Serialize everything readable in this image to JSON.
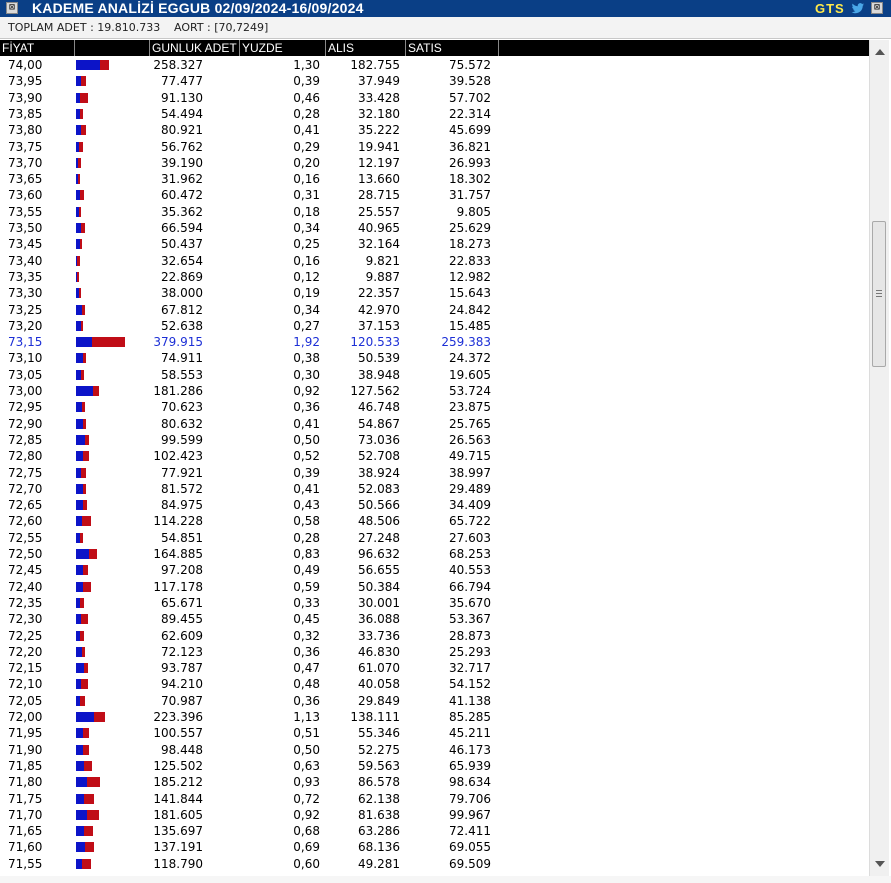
{
  "window": {
    "close_glyph": "⊠",
    "title": "KADEME ANALİZİ EGGUB 02/09/2024-16/09/2024",
    "brand": "GTS",
    "brand_icon": "twitter-bird-icon",
    "right_close_glyph": "⊠"
  },
  "summary": {
    "total_label": "TOPLAM ADET : 19.810.733",
    "aort_label": "AORT :  [70,7249]"
  },
  "columns": {
    "price": "FİYAT",
    "volume": "GUNLUK ADET",
    "percent": "YUZDE",
    "buy": "ALIS",
    "sell": "SATIS"
  },
  "colors": {
    "title_bg": "#0a3f86",
    "brand": "#ffe94a",
    "header_bg": "#000000",
    "buy_bar": "#0c14c8",
    "sell_bar": "#c00d17",
    "highlight_text": "#1c2fd6"
  },
  "highlight_price": "73,15",
  "rows": [
    {
      "price": "74,00",
      "volume": "258.327",
      "percent": "1,30",
      "buy": "182.755",
      "sell": "75.572",
      "buy_n": 182755,
      "sell_n": 75572
    },
    {
      "price": "73,95",
      "volume": "77.477",
      "percent": "0,39",
      "buy": "37.949",
      "sell": "39.528",
      "buy_n": 37949,
      "sell_n": 39528
    },
    {
      "price": "73,90",
      "volume": "91.130",
      "percent": "0,46",
      "buy": "33.428",
      "sell": "57.702",
      "buy_n": 33428,
      "sell_n": 57702
    },
    {
      "price": "73,85",
      "volume": "54.494",
      "percent": "0,28",
      "buy": "32.180",
      "sell": "22.314",
      "buy_n": 32180,
      "sell_n": 22314
    },
    {
      "price": "73,80",
      "volume": "80.921",
      "percent": "0,41",
      "buy": "35.222",
      "sell": "45.699",
      "buy_n": 35222,
      "sell_n": 45699
    },
    {
      "price": "73,75",
      "volume": "56.762",
      "percent": "0,29",
      "buy": "19.941",
      "sell": "36.821",
      "buy_n": 19941,
      "sell_n": 36821
    },
    {
      "price": "73,70",
      "volume": "39.190",
      "percent": "0,20",
      "buy": "12.197",
      "sell": "26.993",
      "buy_n": 12197,
      "sell_n": 26993
    },
    {
      "price": "73,65",
      "volume": "31.962",
      "percent": "0,16",
      "buy": "13.660",
      "sell": "18.302",
      "buy_n": 13660,
      "sell_n": 18302
    },
    {
      "price": "73,60",
      "volume": "60.472",
      "percent": "0,31",
      "buy": "28.715",
      "sell": "31.757",
      "buy_n": 28715,
      "sell_n": 31757
    },
    {
      "price": "73,55",
      "volume": "35.362",
      "percent": "0,18",
      "buy": "25.557",
      "sell": "9.805",
      "buy_n": 25557,
      "sell_n": 9805
    },
    {
      "price": "73,50",
      "volume": "66.594",
      "percent": "0,34",
      "buy": "40.965",
      "sell": "25.629",
      "buy_n": 40965,
      "sell_n": 25629
    },
    {
      "price": "73,45",
      "volume": "50.437",
      "percent": "0,25",
      "buy": "32.164",
      "sell": "18.273",
      "buy_n": 32164,
      "sell_n": 18273
    },
    {
      "price": "73,40",
      "volume": "32.654",
      "percent": "0,16",
      "buy": "9.821",
      "sell": "22.833",
      "buy_n": 9821,
      "sell_n": 22833
    },
    {
      "price": "73,35",
      "volume": "22.869",
      "percent": "0,12",
      "buy": "9.887",
      "sell": "12.982",
      "buy_n": 9887,
      "sell_n": 12982
    },
    {
      "price": "73,30",
      "volume": "38.000",
      "percent": "0,19",
      "buy": "22.357",
      "sell": "15.643",
      "buy_n": 22357,
      "sell_n": 15643
    },
    {
      "price": "73,25",
      "volume": "67.812",
      "percent": "0,34",
      "buy": "42.970",
      "sell": "24.842",
      "buy_n": 42970,
      "sell_n": 24842
    },
    {
      "price": "73,20",
      "volume": "52.638",
      "percent": "0,27",
      "buy": "37.153",
      "sell": "15.485",
      "buy_n": 37153,
      "sell_n": 15485
    },
    {
      "price": "73,15",
      "volume": "379.915",
      "percent": "1,92",
      "buy": "120.533",
      "sell": "259.383",
      "buy_n": 120533,
      "sell_n": 259383
    },
    {
      "price": "73,10",
      "volume": "74.911",
      "percent": "0,38",
      "buy": "50.539",
      "sell": "24.372",
      "buy_n": 50539,
      "sell_n": 24372
    },
    {
      "price": "73,05",
      "volume": "58.553",
      "percent": "0,30",
      "buy": "38.948",
      "sell": "19.605",
      "buy_n": 38948,
      "sell_n": 19605
    },
    {
      "price": "73,00",
      "volume": "181.286",
      "percent": "0,92",
      "buy": "127.562",
      "sell": "53.724",
      "buy_n": 127562,
      "sell_n": 53724
    },
    {
      "price": "72,95",
      "volume": "70.623",
      "percent": "0,36",
      "buy": "46.748",
      "sell": "23.875",
      "buy_n": 46748,
      "sell_n": 23875
    },
    {
      "price": "72,90",
      "volume": "80.632",
      "percent": "0,41",
      "buy": "54.867",
      "sell": "25.765",
      "buy_n": 54867,
      "sell_n": 25765
    },
    {
      "price": "72,85",
      "volume": "99.599",
      "percent": "0,50",
      "buy": "73.036",
      "sell": "26.563",
      "buy_n": 73036,
      "sell_n": 26563
    },
    {
      "price": "72,80",
      "volume": "102.423",
      "percent": "0,52",
      "buy": "52.708",
      "sell": "49.715",
      "buy_n": 52708,
      "sell_n": 49715
    },
    {
      "price": "72,75",
      "volume": "77.921",
      "percent": "0,39",
      "buy": "38.924",
      "sell": "38.997",
      "buy_n": 38924,
      "sell_n": 38997
    },
    {
      "price": "72,70",
      "volume": "81.572",
      "percent": "0,41",
      "buy": "52.083",
      "sell": "29.489",
      "buy_n": 52083,
      "sell_n": 29489
    },
    {
      "price": "72,65",
      "volume": "84.975",
      "percent": "0,43",
      "buy": "50.566",
      "sell": "34.409",
      "buy_n": 50566,
      "sell_n": 34409
    },
    {
      "price": "72,60",
      "volume": "114.228",
      "percent": "0,58",
      "buy": "48.506",
      "sell": "65.722",
      "buy_n": 48506,
      "sell_n": 65722
    },
    {
      "price": "72,55",
      "volume": "54.851",
      "percent": "0,28",
      "buy": "27.248",
      "sell": "27.603",
      "buy_n": 27248,
      "sell_n": 27603
    },
    {
      "price": "72,50",
      "volume": "164.885",
      "percent": "0,83",
      "buy": "96.632",
      "sell": "68.253",
      "buy_n": 96632,
      "sell_n": 68253
    },
    {
      "price": "72,45",
      "volume": "97.208",
      "percent": "0,49",
      "buy": "56.655",
      "sell": "40.553",
      "buy_n": 56655,
      "sell_n": 40553
    },
    {
      "price": "72,40",
      "volume": "117.178",
      "percent": "0,59",
      "buy": "50.384",
      "sell": "66.794",
      "buy_n": 50384,
      "sell_n": 66794
    },
    {
      "price": "72,35",
      "volume": "65.671",
      "percent": "0,33",
      "buy": "30.001",
      "sell": "35.670",
      "buy_n": 30001,
      "sell_n": 35670
    },
    {
      "price": "72,30",
      "volume": "89.455",
      "percent": "0,45",
      "buy": "36.088",
      "sell": "53.367",
      "buy_n": 36088,
      "sell_n": 53367
    },
    {
      "price": "72,25",
      "volume": "62.609",
      "percent": "0,32",
      "buy": "33.736",
      "sell": "28.873",
      "buy_n": 33736,
      "sell_n": 28873
    },
    {
      "price": "72,20",
      "volume": "72.123",
      "percent": "0,36",
      "buy": "46.830",
      "sell": "25.293",
      "buy_n": 46830,
      "sell_n": 25293
    },
    {
      "price": "72,15",
      "volume": "93.787",
      "percent": "0,47",
      "buy": "61.070",
      "sell": "32.717",
      "buy_n": 61070,
      "sell_n": 32717
    },
    {
      "price": "72,10",
      "volume": "94.210",
      "percent": "0,48",
      "buy": "40.058",
      "sell": "54.152",
      "buy_n": 40058,
      "sell_n": 54152
    },
    {
      "price": "72,05",
      "volume": "70.987",
      "percent": "0,36",
      "buy": "29.849",
      "sell": "41.138",
      "buy_n": 29849,
      "sell_n": 41138
    },
    {
      "price": "72,00",
      "volume": "223.396",
      "percent": "1,13",
      "buy": "138.111",
      "sell": "85.285",
      "buy_n": 138111,
      "sell_n": 85285
    },
    {
      "price": "71,95",
      "volume": "100.557",
      "percent": "0,51",
      "buy": "55.346",
      "sell": "45.211",
      "buy_n": 55346,
      "sell_n": 45211
    },
    {
      "price": "71,90",
      "volume": "98.448",
      "percent": "0,50",
      "buy": "52.275",
      "sell": "46.173",
      "buy_n": 52275,
      "sell_n": 46173
    },
    {
      "price": "71,85",
      "volume": "125.502",
      "percent": "0,63",
      "buy": "59.563",
      "sell": "65.939",
      "buy_n": 59563,
      "sell_n": 65939
    },
    {
      "price": "71,80",
      "volume": "185.212",
      "percent": "0,93",
      "buy": "86.578",
      "sell": "98.634",
      "buy_n": 86578,
      "sell_n": 98634
    },
    {
      "price": "71,75",
      "volume": "141.844",
      "percent": "0,72",
      "buy": "62.138",
      "sell": "79.706",
      "buy_n": 62138,
      "sell_n": 79706
    },
    {
      "price": "71,70",
      "volume": "181.605",
      "percent": "0,92",
      "buy": "81.638",
      "sell": "99.967",
      "buy_n": 81638,
      "sell_n": 99967
    },
    {
      "price": "71,65",
      "volume": "135.697",
      "percent": "0,68",
      "buy": "63.286",
      "sell": "72.411",
      "buy_n": 63286,
      "sell_n": 72411
    },
    {
      "price": "71,60",
      "volume": "137.191",
      "percent": "0,69",
      "buy": "68.136",
      "sell": "69.055",
      "buy_n": 68136,
      "sell_n": 69055
    },
    {
      "price": "71,55",
      "volume": "118.790",
      "percent": "0,60",
      "buy": "49.281",
      "sell": "69.509",
      "buy_n": 49281,
      "sell_n": 69509
    }
  ]
}
